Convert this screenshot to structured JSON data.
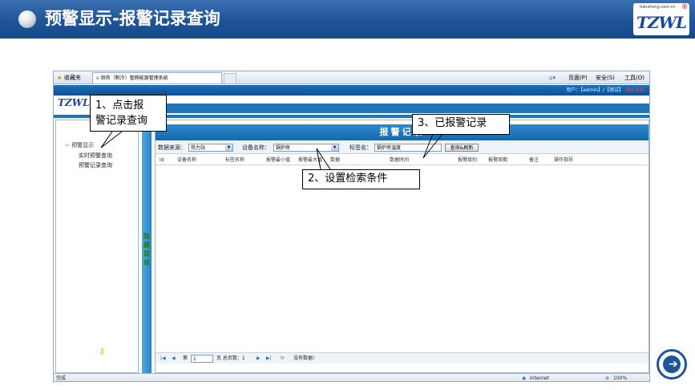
{
  "slide": {
    "title": "预警显示-报警记录查询",
    "logo_text": "TZWL",
    "logo_small": "tianzheng.com.cn",
    "logo_mark": "®"
  },
  "browser": {
    "favorites_label": "收藏夹",
    "tab_title": "供热（制冷）管网能源管理系统",
    "menu_items": [
      "页面(P)",
      "安全(S)",
      "工具(O)"
    ],
    "status_left": "完成",
    "status_zone": "Internet",
    "zoom": "100%"
  },
  "app": {
    "logo": "TZWL",
    "user_info": "用户：【admin】/【测试】",
    "logout_label": "退出系统",
    "sidebar": {
      "section": "预警显示",
      "items": [
        "实时预警查询",
        "预警记录查询"
      ]
    },
    "toggle_label": "隐藏菜单",
    "panel_title": "报警记录",
    "filters": {
      "source_label": "数据来源：",
      "source_value": "热力站",
      "device_label": "设备名称：",
      "device_value": "锅炉房",
      "tag_label": "标签名：",
      "tag_value": "锅炉房温度",
      "query_button": "查询&刷新"
    },
    "table_headers": [
      "Id",
      "设备名称",
      "标签名称",
      "报警最小值",
      "报警最大值",
      "数据",
      "数据时间",
      "报警级别",
      "报警周期",
      "备注",
      "操作指导"
    ],
    "pager": {
      "page_prefix": "第",
      "page_value": "1",
      "page_suffix": "页 总页数：1",
      "empty_text": "没有数据!"
    }
  },
  "callouts": {
    "step1": "1、点击报\n警记录查询",
    "step2": "2、设置检索条件",
    "step3": "3、已报警记录"
  },
  "colors": {
    "header_blue": "#1f5597",
    "app_blue": "#1d76bb"
  }
}
